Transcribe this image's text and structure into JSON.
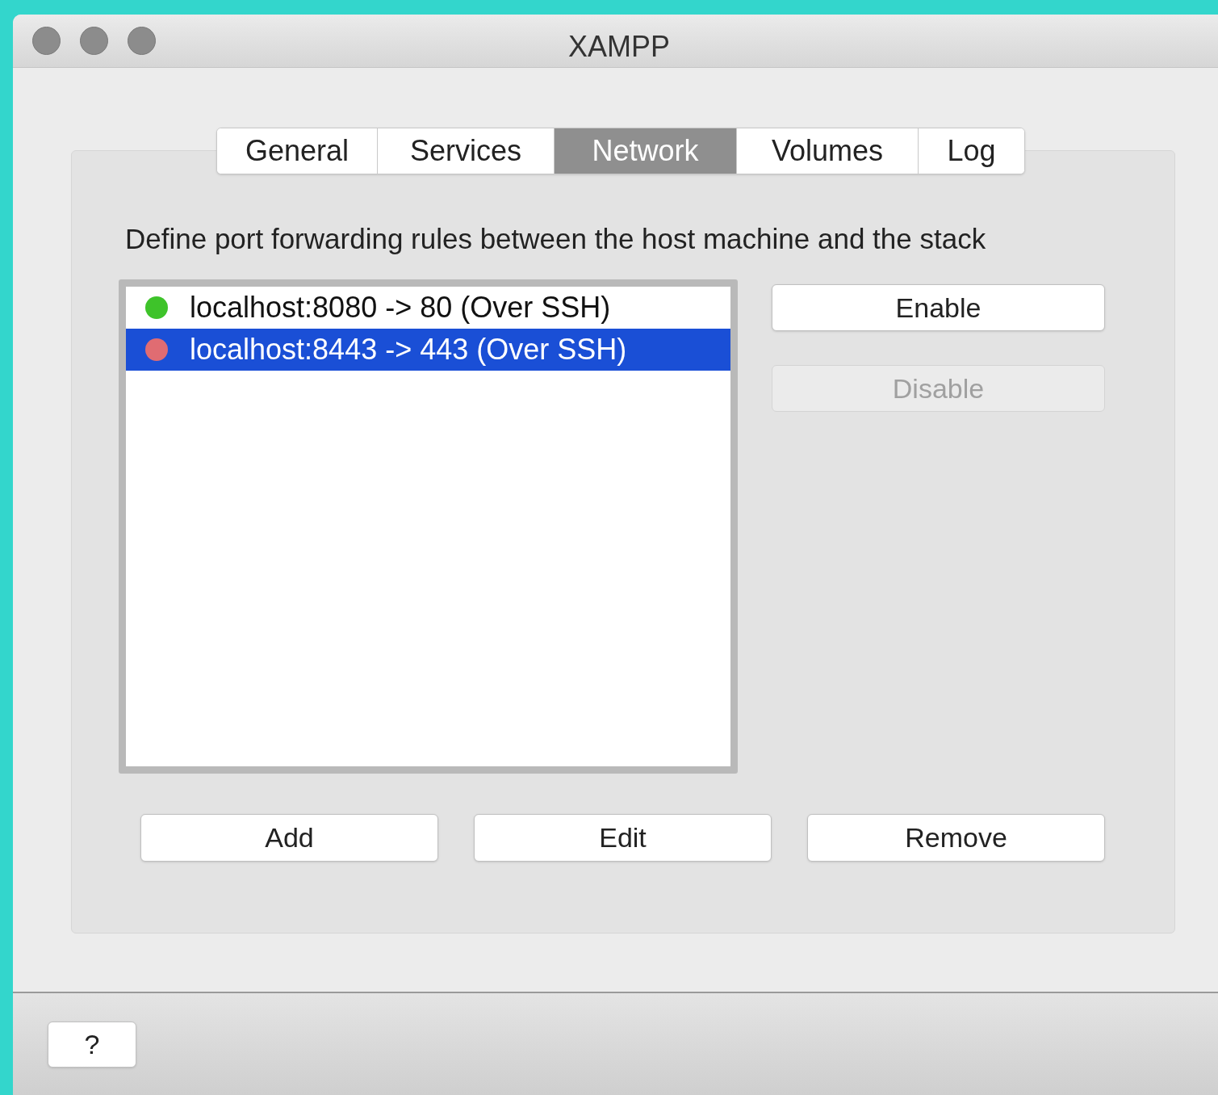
{
  "window": {
    "title": "XAMPP"
  },
  "tabs": [
    {
      "label": "General",
      "selected": false
    },
    {
      "label": "Services",
      "selected": false
    },
    {
      "label": "Network",
      "selected": true
    },
    {
      "label": "Volumes",
      "selected": false
    },
    {
      "label": "Log",
      "selected": false
    }
  ],
  "description": "Define port forwarding rules between the host machine and the stack",
  "rules": [
    {
      "label": "localhost:8080 -> 80 (Over SSH)",
      "color": "#3ec32a",
      "selected": false
    },
    {
      "label": "localhost:8443 -> 443 (Over SSH)",
      "color": "#e06c72",
      "selected": true
    }
  ],
  "side_buttons": [
    {
      "label": "Enable",
      "disabled": false
    },
    {
      "label": "Disable",
      "disabled": true
    }
  ],
  "bottom_buttons": [
    {
      "label": "Add"
    },
    {
      "label": "Edit"
    },
    {
      "label": "Remove"
    }
  ],
  "help_button": {
    "label": "?"
  }
}
